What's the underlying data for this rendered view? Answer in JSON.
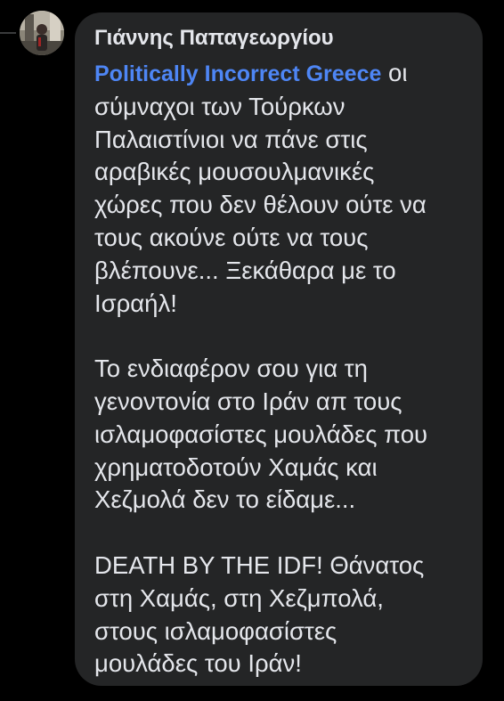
{
  "comment": {
    "author": "Γιάννης Παπαγεωργίου",
    "mention": "Politically Incorrect Greece",
    "paragraphs": [
      [
        " οι",
        "σύμναχοι των Τούρκων",
        "Παλαιστίνιοι να πάνε στις",
        "αραβικές μουσουλμανικές",
        "χώρες που δεν θέλουν ούτε να",
        "τους ακούνε ούτε να τους",
        "βλέπουνε... Ξεκάθαρα με το",
        "Ισραήλ!"
      ],
      [
        "Το ενδιαφέρον σου για τη",
        "γενοντονία στο Ιράν απ τους",
        "ισλαμοφασίστες μουλάδες που",
        "χρηματοδοτούν Χαμάς και",
        "Χεζμολά δεν το είδαμε..."
      ],
      [
        "DEATH BY THE IDF! Θάνατος",
        "στη Χαμάς, στη Χεζμπολά,",
        "στους ισλαμοφασίστες",
        "μουλάδες του Ιράν!"
      ]
    ]
  },
  "colors": {
    "background": "#000000",
    "bubble": "#242526",
    "text": "#e4e6eb",
    "mention": "#4e86f5"
  }
}
